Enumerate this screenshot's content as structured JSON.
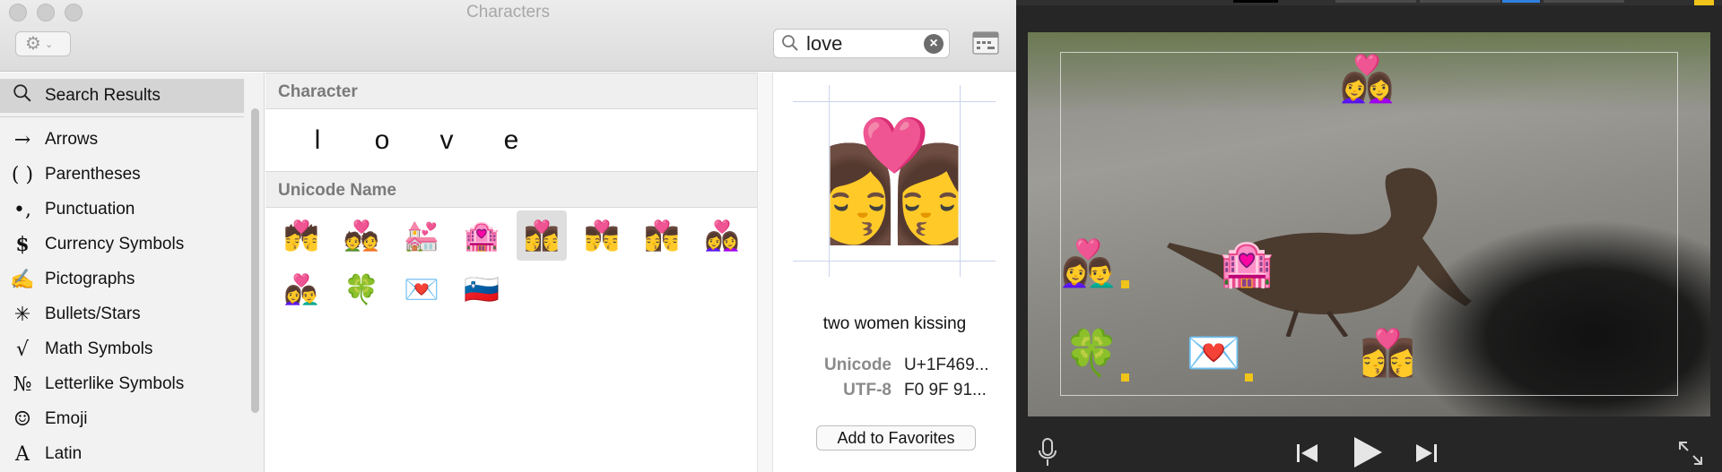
{
  "characters_window": {
    "title": "Characters",
    "search": {
      "value": "love",
      "placeholder": "Search"
    },
    "sidebar": {
      "items": [
        {
          "icon": "search-icon",
          "glyph": "",
          "label": "Search Results",
          "selected": true
        },
        {
          "icon": "arrow-icon",
          "glyph": "→",
          "label": "Arrows"
        },
        {
          "icon": "parentheses-icon",
          "glyph": "( )",
          "label": "Parentheses"
        },
        {
          "icon": "punctuation-icon",
          "glyph": "•,",
          "label": "Punctuation"
        },
        {
          "icon": "dollar-icon",
          "glyph": "$",
          "label": "Currency Symbols"
        },
        {
          "icon": "pictograph-icon",
          "glyph": "✍",
          "label": "Pictographs"
        },
        {
          "icon": "asterisk-icon",
          "glyph": "✳",
          "label": "Bullets/Stars"
        },
        {
          "icon": "sqrt-icon",
          "glyph": "√",
          "label": "Math Symbols"
        },
        {
          "icon": "numero-icon",
          "glyph": "№",
          "label": "Letterlike Symbols"
        },
        {
          "icon": "smiley-icon",
          "glyph": "☺",
          "label": "Emoji"
        },
        {
          "icon": "latin-icon",
          "glyph": "A",
          "label": "Latin"
        }
      ]
    },
    "sections": {
      "character_header": "Character",
      "characters": [
        "l",
        "o",
        "v",
        "e"
      ],
      "unicode_header": "Unicode Name"
    },
    "emoji_results": [
      "💏",
      "💑",
      "💒",
      "🏩",
      "👩‍❤️‍💋‍👩",
      "👨‍❤️‍💋‍👨",
      "👩‍❤️‍💋‍👨",
      "👩‍❤️‍👩",
      "👩‍❤️‍👨",
      "🍀",
      "💌",
      "🇸🇮"
    ],
    "selected_index": 4,
    "preview": {
      "glyph": "👩‍❤️‍💋‍👩",
      "name": "two women kissing",
      "unicode_label": "Unicode",
      "unicode_value": "U+1F469...",
      "utf8_label": "UTF-8",
      "utf8_value": "F0 9F 91...",
      "add_favorites": "Add to Favorites"
    }
  },
  "player": {
    "overlay_emojis": [
      {
        "glyph": "👩‍❤️‍👩"
      },
      {
        "glyph": "👩‍❤️‍👨"
      },
      {
        "glyph": "🏩"
      },
      {
        "glyph": "🍀"
      },
      {
        "glyph": "💌"
      },
      {
        "glyph": "👩‍❤️‍💋‍👩"
      }
    ],
    "controls": [
      "microphone-icon",
      "skip-back-icon",
      "play-icon",
      "skip-forward-icon",
      "fullscreen-icon"
    ]
  },
  "colors": {
    "sidebar_selected": "#d4d4d4",
    "handle": "#f0c419",
    "accent_blue": "#2f7fe0"
  }
}
